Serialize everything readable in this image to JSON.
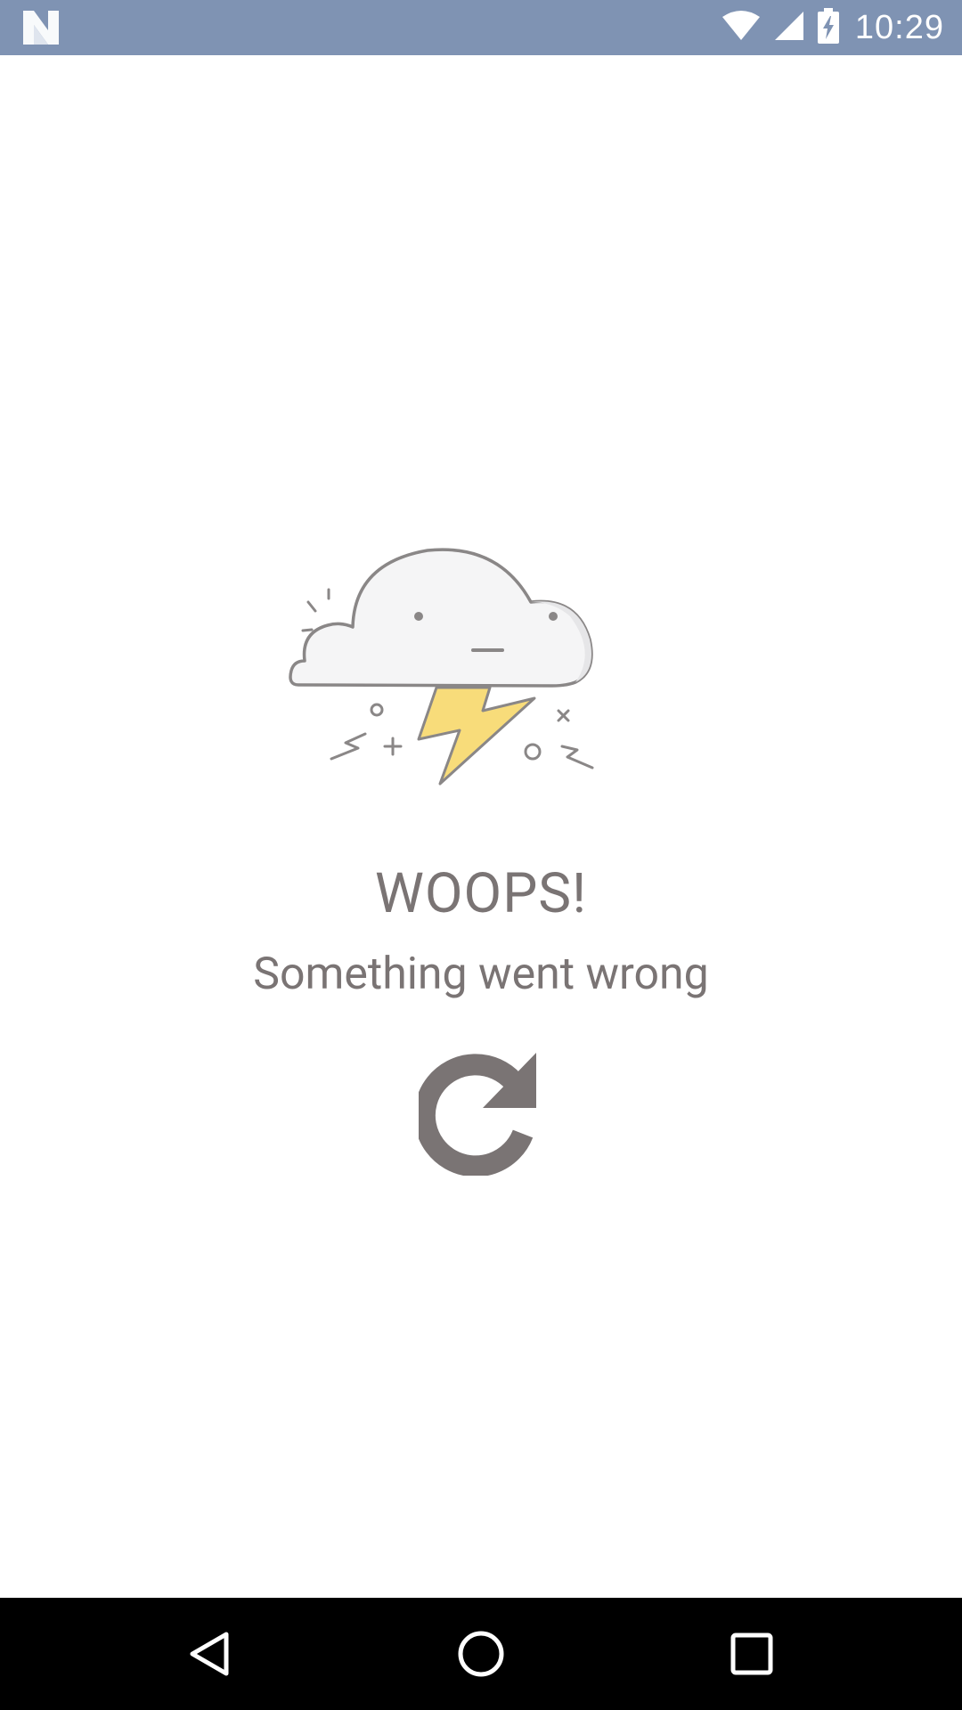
{
  "status_bar": {
    "time": "10:29",
    "left_icon": "n-notification-icon",
    "icons": [
      "wifi-icon",
      "cellular-signal-icon",
      "battery-charging-icon"
    ],
    "background_color": "#7f93b3"
  },
  "error": {
    "illustration": "storm-cloud-illustration",
    "title": "WOOPS!",
    "message": "Something went wrong",
    "retry_icon": "refresh-icon",
    "text_color": "#7a7474"
  },
  "nav_bar": {
    "buttons": [
      "back-icon",
      "home-icon",
      "recents-icon"
    ]
  }
}
